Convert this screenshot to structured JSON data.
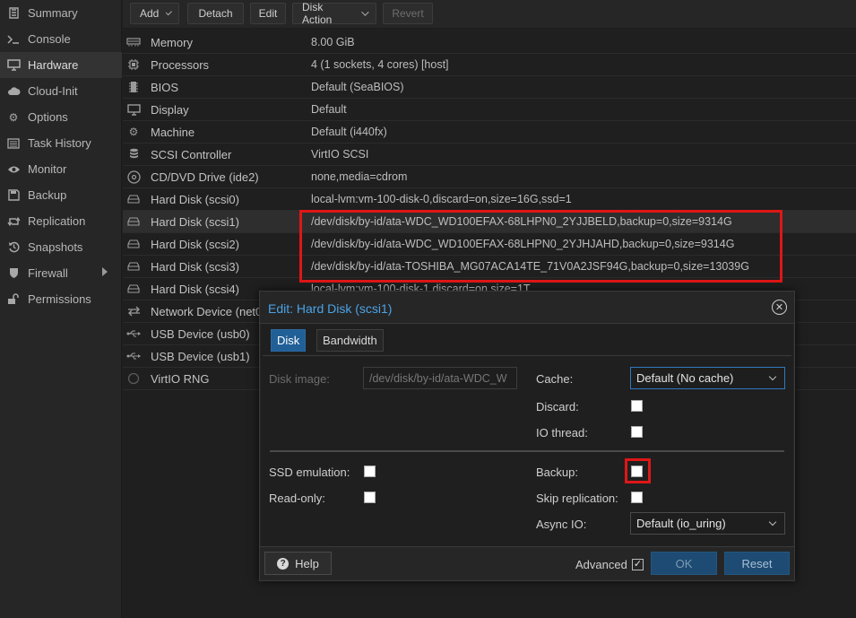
{
  "sidebar": {
    "items": [
      {
        "label": "Summary",
        "icon": "summary-icon"
      },
      {
        "label": "Console",
        "icon": "console-icon"
      },
      {
        "label": "Hardware",
        "icon": "monitor-icon"
      },
      {
        "label": "Cloud-Init",
        "icon": "cloud-icon"
      },
      {
        "label": "Options",
        "icon": "gear-icon"
      },
      {
        "label": "Task History",
        "icon": "list-icon"
      },
      {
        "label": "Monitor",
        "icon": "eye-icon"
      },
      {
        "label": "Backup",
        "icon": "floppy-icon"
      },
      {
        "label": "Replication",
        "icon": "retweet-icon"
      },
      {
        "label": "Snapshots",
        "icon": "history-icon"
      },
      {
        "label": "Firewall",
        "icon": "shield-icon"
      },
      {
        "label": "Permissions",
        "icon": "unlock-icon"
      }
    ]
  },
  "toolbar": {
    "add": "Add",
    "detach": "Detach",
    "edit": "Edit",
    "disk_action": "Disk Action",
    "revert": "Revert"
  },
  "hardware": {
    "rows": [
      {
        "name": "Memory",
        "value": "8.00 GiB",
        "icon": "memory-icon"
      },
      {
        "name": "Processors",
        "value": "4 (1 sockets, 4 cores) [host]",
        "icon": "cpu-icon"
      },
      {
        "name": "BIOS",
        "value": "Default (SeaBIOS)",
        "icon": "microchip-icon"
      },
      {
        "name": "Display",
        "value": "Default",
        "icon": "desktop-icon"
      },
      {
        "name": "Machine",
        "value": "Default (i440fx)",
        "icon": "cogs-icon"
      },
      {
        "name": "SCSI Controller",
        "value": "VirtIO SCSI",
        "icon": "database-icon"
      },
      {
        "name": "CD/DVD Drive (ide2)",
        "value": "none,media=cdrom",
        "icon": "cdrom-icon"
      },
      {
        "name": "Hard Disk (scsi0)",
        "value": "local-lvm:vm-100-disk-0,discard=on,size=16G,ssd=1",
        "icon": "hdd-icon"
      },
      {
        "name": "Hard Disk (scsi1)",
        "value": "/dev/disk/by-id/ata-WDC_WD100EFAX-68LHPN0_2YJJBELD,backup=0,size=9314G",
        "icon": "hdd-icon"
      },
      {
        "name": "Hard Disk (scsi2)",
        "value": "/dev/disk/by-id/ata-WDC_WD100EFAX-68LHPN0_2YJHJAHD,backup=0,size=9314G",
        "icon": "hdd-icon"
      },
      {
        "name": "Hard Disk (scsi3)",
        "value": "/dev/disk/by-id/ata-TOSHIBA_MG07ACA14TE_71V0A2JSF94G,backup=0,size=13039G",
        "icon": "hdd-icon"
      },
      {
        "name": "Hard Disk (scsi4)",
        "value": "local-lvm:vm-100-disk-1,discard=on,size=1T",
        "icon": "hdd-icon"
      },
      {
        "name": "Network Device (net0)",
        "value": "",
        "icon": "exchange-icon"
      },
      {
        "name": "USB Device (usb0)",
        "value": "",
        "icon": "usb-icon"
      },
      {
        "name": "USB Device (usb1)",
        "value": "",
        "icon": "usb-icon"
      },
      {
        "name": "VirtIO RNG",
        "value": "",
        "icon": "rng-icon"
      }
    ]
  },
  "dialog": {
    "title": "Edit: Hard Disk (scsi1)",
    "tabs": [
      "Disk",
      "Bandwidth"
    ],
    "disk_image_label": "Disk image:",
    "disk_image_value": "/dev/disk/by-id/ata-WDC_W",
    "cache_label": "Cache:",
    "cache_value": "Default (No cache)",
    "discard_label": "Discard:",
    "io_thread_label": "IO thread:",
    "ssd_label": "SSD emulation:",
    "readonly_label": "Read-only:",
    "backup_label": "Backup:",
    "skip_repl_label": "Skip replication:",
    "async_io_label": "Async IO:",
    "async_io_value": "Default (io_uring)",
    "help": "Help",
    "advanced": "Advanced",
    "advanced_check": "✓",
    "ok": "OK",
    "reset": "Reset"
  },
  "colors": {
    "accent_title": "#4aa3e6",
    "highlight": "#e01616",
    "tab_active": "#215f97"
  }
}
